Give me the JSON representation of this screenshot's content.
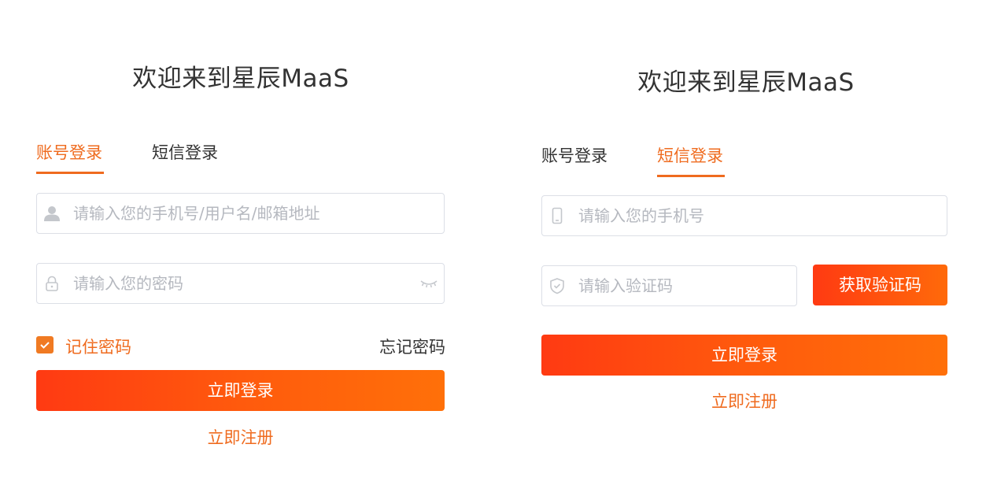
{
  "left": {
    "title": "欢迎来到星辰MaaS",
    "tabs": [
      {
        "label": "账号登录",
        "active": true
      },
      {
        "label": "短信登录",
        "active": false
      }
    ],
    "username": {
      "placeholder": "请输入您的手机号/用户名/邮箱地址",
      "icon": "user-icon"
    },
    "password": {
      "placeholder": "请输入您的密码",
      "icon": "lock-icon",
      "toggle_icon": "eye-closed-icon"
    },
    "remember": {
      "label": "记住密码",
      "checked": true
    },
    "forgot_label": "忘记密码",
    "login_label": "立即登录",
    "register_label": "立即注册"
  },
  "right": {
    "title": "欢迎来到星辰MaaS",
    "tabs": [
      {
        "label": "账号登录",
        "active": false
      },
      {
        "label": "短信登录",
        "active": true
      }
    ],
    "phone": {
      "placeholder": "请输入您的手机号",
      "icon": "phone-icon"
    },
    "code": {
      "placeholder": "请输入验证码",
      "icon": "shield-icon"
    },
    "get_code_label": "获取验证码",
    "login_label": "立即登录",
    "register_label": "立即注册"
  },
  "colors": {
    "accent": "#ef6b1f",
    "gradient_start": "#ff3a12",
    "gradient_end": "#ff7009",
    "text": "#333333",
    "placeholder": "#b5b8bf",
    "border": "#dcdfe6"
  }
}
